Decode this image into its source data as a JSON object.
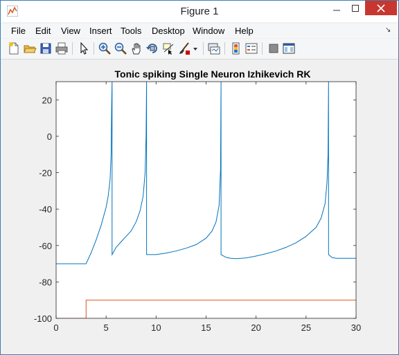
{
  "window": {
    "title": "Figure 1"
  },
  "menu": [
    "File",
    "Edit",
    "View",
    "Insert",
    "Tools",
    "Desktop",
    "Window",
    "Help"
  ],
  "toolbar": {
    "icons": [
      "new-figure-icon",
      "open-file-icon",
      "save-icon",
      "print-icon",
      "pointer-icon",
      "zoom-in-icon",
      "zoom-out-icon",
      "pan-icon",
      "rotate-3d-icon",
      "data-cursor-icon",
      "brush-icon",
      "brush-dropdown-icon",
      "link-plot-icon",
      "colorbar-icon",
      "legend-icon",
      "hide-plot-tools-icon",
      "show-plot-tools-icon"
    ]
  },
  "chart_data": {
    "type": "line",
    "title": "Tonic spiking Single Neuron Izhikevich RK",
    "xlim": [
      0,
      30
    ],
    "ylim": [
      -100,
      30
    ],
    "xticks": [
      0,
      5,
      10,
      15,
      20,
      25,
      30
    ],
    "yticks": [
      -100,
      -80,
      -60,
      -40,
      -20,
      0,
      20
    ],
    "grid": false,
    "series": [
      {
        "color": "#0072bd",
        "x": [
          0,
          3,
          3.5,
          4,
          4.5,
          5,
          5.2,
          5.4,
          5.5,
          5.55,
          5.6,
          5.6,
          5.8,
          6,
          6.5,
          7,
          7.5,
          8,
          8.4,
          8.7,
          8.9,
          9.0,
          9.05,
          9.05,
          9.5,
          10,
          11,
          12,
          13,
          14,
          15,
          15.6,
          16.0,
          16.3,
          16.45,
          16.5,
          16.5,
          17,
          17.5,
          18,
          18.5,
          19,
          20,
          21,
          22,
          23,
          24,
          25,
          26,
          26.5,
          26.9,
          27.1,
          27.2,
          27.25,
          27.25,
          27.6,
          28,
          29,
          30
        ],
        "y": [
          -70,
          -70,
          -64,
          -57,
          -49,
          -39,
          -33,
          -24,
          -10,
          15,
          30,
          -65,
          -63,
          -61,
          -58,
          -55,
          -52,
          -47,
          -41,
          -33,
          -20,
          0,
          30,
          -65,
          -65,
          -65,
          -64.2,
          -63,
          -61.5,
          -59.5,
          -56,
          -52,
          -47,
          -38,
          -18,
          30,
          -65,
          -66.5,
          -67.1,
          -67.2,
          -67,
          -66.8,
          -65.8,
          -64.5,
          -63,
          -61,
          -58.5,
          -55,
          -50,
          -45,
          -37,
          -25,
          -10,
          30,
          -65,
          -66.6,
          -67,
          -67,
          -67
        ]
      },
      {
        "color": "#d95319",
        "x": [
          0,
          3,
          3,
          30
        ],
        "y": [
          -100,
          -100,
          -90,
          -90
        ]
      }
    ]
  }
}
